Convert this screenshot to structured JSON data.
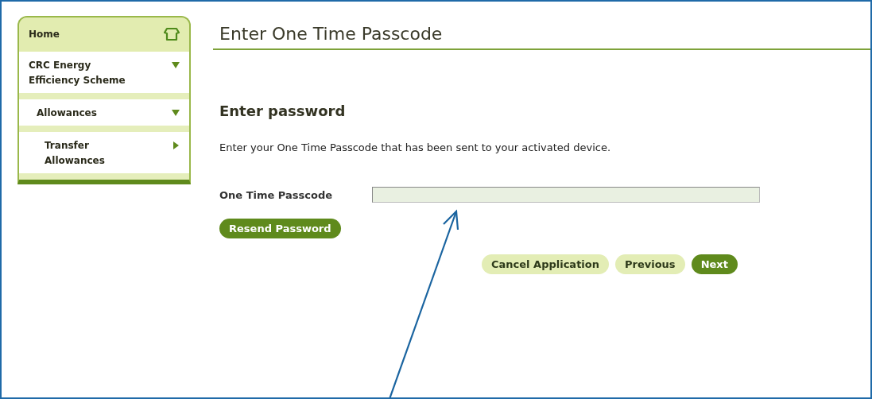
{
  "sidebar": {
    "items": [
      {
        "kind": "home",
        "label": "Home"
      },
      {
        "kind": "branch",
        "label": "CRC Energy Efficiency Scheme",
        "expanded": true,
        "children": [
          {
            "kind": "branch",
            "label": "Allowances",
            "expanded": true,
            "children": [
              {
                "kind": "branch",
                "label": "Transfer Allowances",
                "expanded": false
              }
            ]
          }
        ]
      }
    ]
  },
  "page_title": "Enter One Time Passcode",
  "section_title": "Enter password",
  "instruction": "Enter your One Time Passcode that has been sent to your activated device.",
  "field": {
    "label": "One Time Passcode"
  },
  "resend_button": {
    "label": "Resend Password",
    "primary": true
  },
  "buttons": [
    {
      "label": "Cancel Application",
      "primary": false
    },
    {
      "label": "Previous",
      "primary": false
    },
    {
      "label": "Next",
      "primary": true
    }
  ],
  "annotation": {
    "kind": "arrow"
  }
}
